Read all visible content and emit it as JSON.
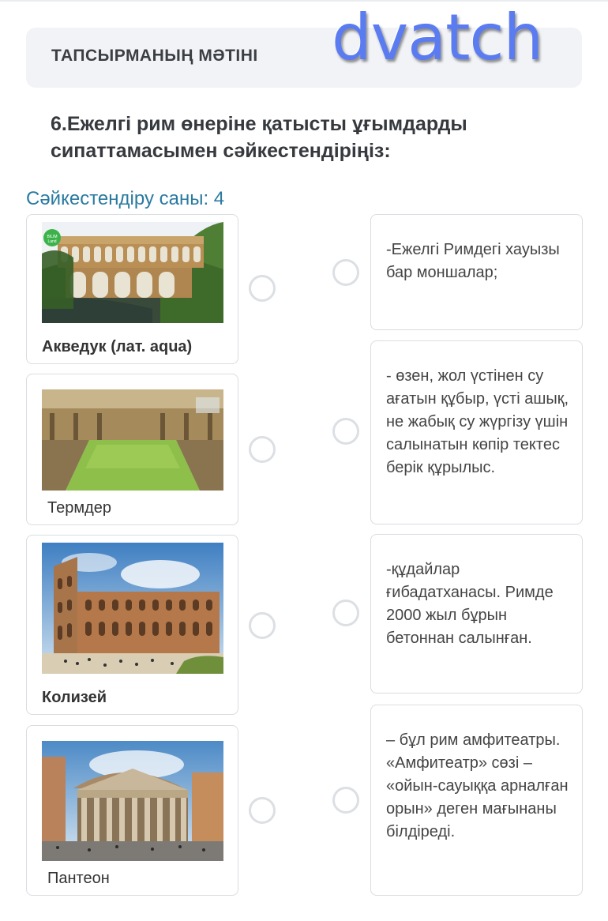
{
  "header": {
    "title": "ТАПСЫРМАНЫҢ МӘТІНІ"
  },
  "watermark": "dvatch",
  "question": "6.Ежелгі рим өнеріне қатысты ұғымдарды сипаттамасымен сәйкестендіріңіз:",
  "match_count": "Сәйкестендіру саны: 4",
  "left_items": [
    {
      "label": "Акведук (лат. aqua)",
      "image": "aqueduct-photo",
      "badge": "BILIM Land"
    },
    {
      "label": "Термдер",
      "image": "roman-baths-photo"
    },
    {
      "label": "Колизей",
      "image": "colosseum-photo"
    },
    {
      "label": "Пантеон",
      "image": "pantheon-photo"
    }
  ],
  "right_items": [
    {
      "text": "-Ежелгі Римдегі хауызы бар моншалар;"
    },
    {
      "text": "- өзен, жол үстінен су ағатын құбыр, үсті ашық, не жабық су жүргізу үшін салынатын көпір тектес берік құрылыс."
    },
    {
      "text": "-құдайлар ғибадатханасы. Римде 2000 жыл бұрын бетоннан салынған."
    },
    {
      "text": "– бұл рим амфитеатры. «Амфитеатр» сөзі – «ойын-сауыққа арналған орын» деген мағынаны білдіреді."
    }
  ],
  "colors": {
    "accent": "#2a7aa0",
    "watermark": "#5b7cf0",
    "header_bg": "#f2f3f6",
    "card_border": "#d9dce1"
  }
}
